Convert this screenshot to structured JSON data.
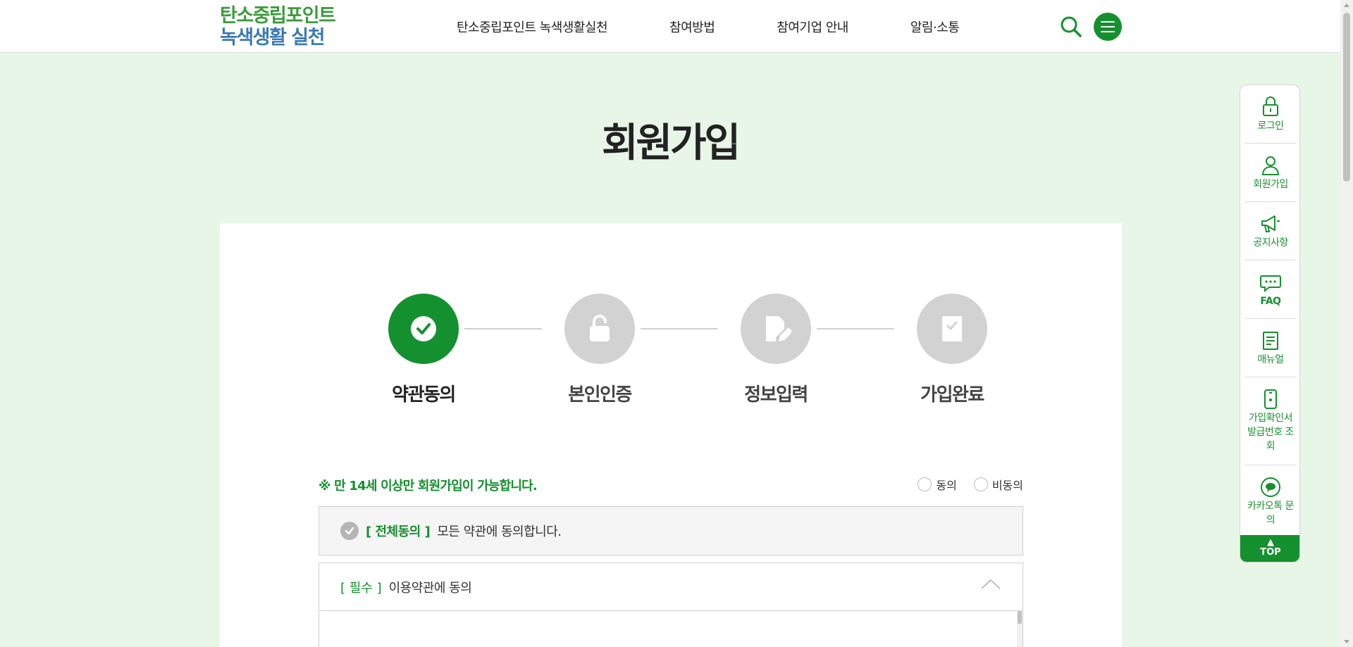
{
  "header": {
    "logo_line1": "탄소중립포인트",
    "logo_line2": "녹색생활 실천",
    "nav": [
      "탄소중립포인트 녹색생활실천",
      "참여방법",
      "참여기업 안내",
      "알림·소통"
    ],
    "search_icon": "search-icon",
    "menu_icon": "hamburger-icon"
  },
  "page": {
    "title": "회원가입"
  },
  "steps": [
    {
      "label": "약관동의",
      "icon": "check-icon",
      "active": true
    },
    {
      "label": "본인인증",
      "icon": "unlock-icon",
      "active": false
    },
    {
      "label": "정보입력",
      "icon": "edit-document-icon",
      "active": false
    },
    {
      "label": "가입완료",
      "icon": "complete-document-icon",
      "active": false
    }
  ],
  "agreement": {
    "age_notice": "※ 만 14세 이상만 회원가입이 가능합니다.",
    "agree_label": "동의",
    "disagree_label": "비동의",
    "all_agree_tag": "[ 전체동의 ]",
    "all_agree_text": "모든 약관에 동의합니다.",
    "terms": [
      {
        "required_tag": "[ 필수 ]",
        "title": "이용약관에 동의"
      }
    ]
  },
  "quick_menu": {
    "items": [
      {
        "label": "로그인",
        "icon": "lock-icon"
      },
      {
        "label": "회원가입",
        "icon": "user-icon"
      },
      {
        "label": "공지사항",
        "icon": "megaphone-icon"
      },
      {
        "label": "FAQ",
        "icon": "chat-bubble-icon"
      },
      {
        "label": "매뉴얼",
        "icon": "manual-icon"
      },
      {
        "label": "가입확인서 발급번호 조회",
        "icon": "phone-icon"
      },
      {
        "label": "카카오톡 문의",
        "icon": "kakaotalk-icon"
      }
    ],
    "top_label": "TOP"
  },
  "colors": {
    "brand_green": "#15902e",
    "page_bg": "#e8f6e8",
    "logo_green": "#3d9b3e",
    "logo_blue": "#3b7ab0",
    "inactive_gray": "#d2d2d2"
  }
}
